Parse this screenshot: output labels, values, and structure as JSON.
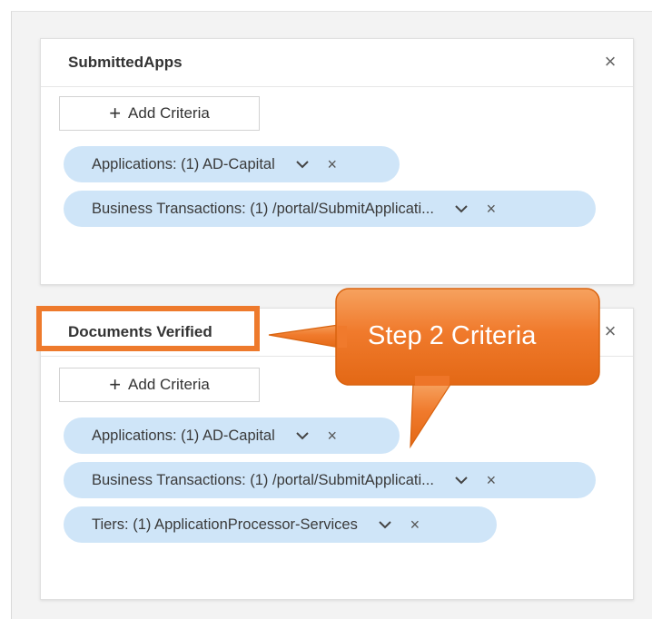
{
  "colors": {
    "pill_bg": "#cfe5f8",
    "callout_orange": "#f07a2c",
    "highlight_orange": "#ee7a2c"
  },
  "cards": [
    {
      "title": "SubmittedApps",
      "close_icon": "×",
      "add_label": "Add Criteria",
      "criteria": [
        "Applications: (1) AD-Capital",
        "Business Transactions: (1) /portal/SubmitApplicati..."
      ]
    },
    {
      "title": "Documents Verified",
      "close_icon": "×",
      "add_label": "Add Criteria",
      "criteria": [
        "Applications: (1) AD-Capital",
        "Business Transactions: (1) /portal/SubmitApplicati...",
        "Tiers: (1) ApplicationProcessor-Services"
      ]
    }
  ],
  "annotation": {
    "callout_text": "Step 2 Criteria"
  },
  "icons": {
    "add": "plus-icon",
    "dropdown": "chevron-down-icon",
    "remove": "close-icon"
  }
}
